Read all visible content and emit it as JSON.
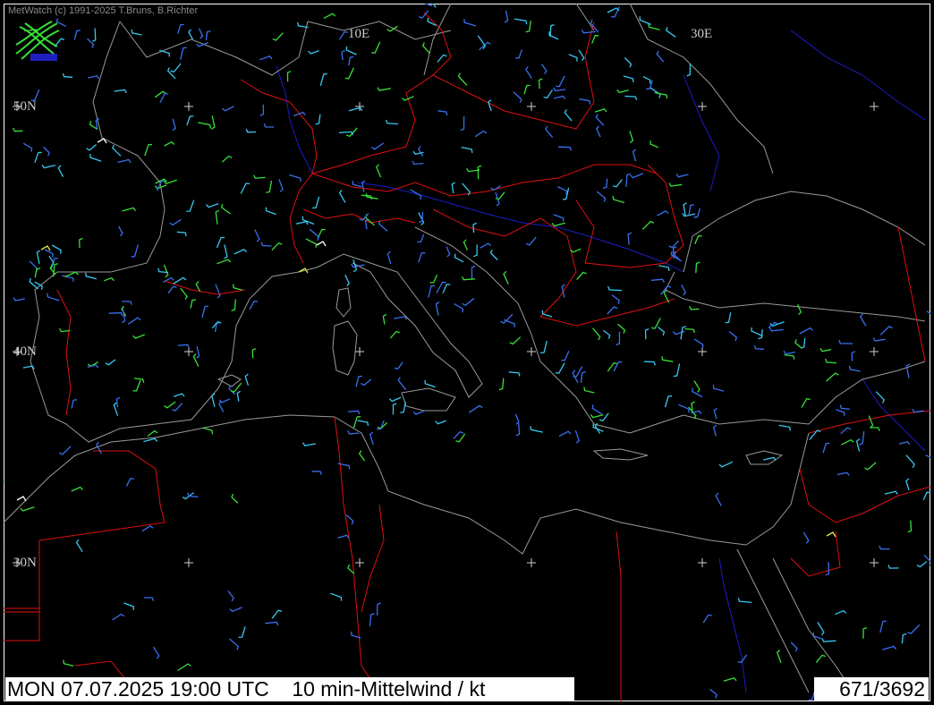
{
  "header": {
    "copyright": "MetWatch  (c) 1991-2025 T.Bruns, B.Richter"
  },
  "grid": {
    "lon_labels": [
      "10E",
      "30E"
    ],
    "lat_labels": [
      "50N",
      "40N",
      "30N"
    ]
  },
  "footer": {
    "datetime_product": "MON 07.07.2025 19:00 UTC    10 min-Mittelwind / kt",
    "station_count": "671/3692"
  },
  "colors": {
    "background": "#000000",
    "coastline": "#9a9a9a",
    "country_border": "#e01010",
    "river": "#1c1cc8",
    "calm": "#ffffff",
    "light": "#38c8f0",
    "moderate": "#3870f0",
    "fresh": "#38e038",
    "strong": "#e8e838"
  },
  "icons": {
    "logo": "metwatch-logo-icon",
    "graticule_cross": "plus-cross-icon",
    "wind_barb": "wind-barb-icon"
  }
}
